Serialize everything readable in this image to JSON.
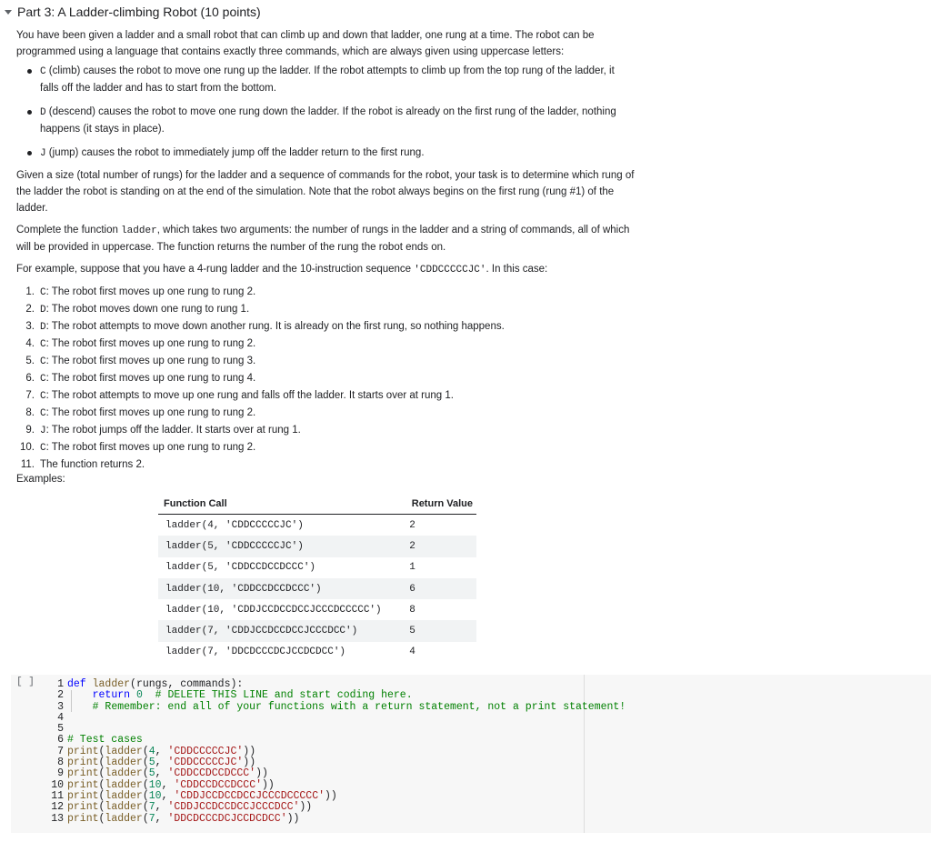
{
  "header": {
    "title": "Part 3: A Ladder-climbing Robot (10 points)"
  },
  "intro": "You have been given a ladder and a small robot that can climb up and down that ladder, one rung at a time. The robot can be programmed using a language that contains exactly three commands, which are always given using uppercase letters:",
  "commands": [
    {
      "code": "C",
      "text": " (climb) causes the robot to move one rung up the ladder. If the robot attempts to climb up from the top rung of the ladder, it falls off the ladder and has to start from the bottom."
    },
    {
      "code": "D",
      "text": " (descend) causes the robot to move one rung down the ladder. If the robot is already on the first rung of the ladder, nothing happens (it stays in place)."
    },
    {
      "code": "J",
      "text": " (jump) causes the robot to immediately jump off the ladder return to the first rung."
    }
  ],
  "task": "Given a size (total number of rungs) for the ladder and a sequence of commands for the robot, your task is to determine which rung of the ladder the robot is standing on at the end of the simulation. Note that the robot always begins on the first rung (rung #1) of the ladder.",
  "complete": {
    "pre": "Complete the function ",
    "fname": "ladder",
    "post": ", which takes two arguments: the number of rungs in the ladder and a string of commands, all of which will be provided in uppercase. The function returns the number of the rung the robot ends on."
  },
  "example_intro": {
    "pre": "For example, suppose that you have a 4-rung ladder and the 10-instruction sequence ",
    "code": "'CDDCCCCCJC'",
    "post": ". In this case:"
  },
  "steps": [
    {
      "n": "1.",
      "code": "C",
      "text": ": The robot first moves up one rung to rung 2."
    },
    {
      "n": "2.",
      "code": "D",
      "text": ": The robot moves down one rung to rung 1."
    },
    {
      "n": "3.",
      "code": "D",
      "text": ": The robot attempts to move down another rung. It is already on the first rung, so nothing happens."
    },
    {
      "n": "4.",
      "code": "C",
      "text": ": The robot first moves up one rung to rung 2."
    },
    {
      "n": "5.",
      "code": "C",
      "text": ": The robot first moves up one rung to rung 3."
    },
    {
      "n": "6.",
      "code": "C",
      "text": ": The robot first moves up one rung to rung 4."
    },
    {
      "n": "7.",
      "code": "C",
      "text": ": The robot attempts to move up one rung and falls off the ladder. It starts over at rung 1."
    },
    {
      "n": "8.",
      "code": "C",
      "text": ": The robot first moves up one rung to rung 2."
    },
    {
      "n": "9.",
      "code": "J",
      "text": ": The robot jumps off the ladder. It starts over at rung 1."
    },
    {
      "n": "10.",
      "code": "C",
      "text": ": The robot first moves up one rung to rung 2."
    },
    {
      "n": "11.",
      "code": "",
      "text": "The function returns 2."
    }
  ],
  "examples_label": "Examples:",
  "table": {
    "headers": [
      "Function Call",
      "Return Value"
    ],
    "rows": [
      [
        "ladder(4, 'CDDCCCCCJC')",
        "2"
      ],
      [
        "ladder(5, 'CDDCCCCCJC')",
        "2"
      ],
      [
        "ladder(5, 'CDDCCDCCDCCC')",
        "1"
      ],
      [
        "ladder(10, 'CDDCCDCCDCCC')",
        "6"
      ],
      [
        "ladder(10, 'CDDJCCDCCDCCJCCCDCCCCC')",
        "8"
      ],
      [
        "ladder(7, 'CDDJCCDCCDCCJCCCDCC')",
        "5"
      ],
      [
        "ladder(7, 'DDCDCCCDCJCCDCDCC')",
        "4"
      ]
    ]
  },
  "cell": {
    "run_label": "[ ]",
    "line_numbers": [
      "1",
      "2",
      "3",
      "4",
      "5",
      "6",
      "7",
      "8",
      "9",
      "10",
      "11",
      "12",
      "13"
    ],
    "code": {
      "l1_def": "def",
      "l1_fn": "ladder",
      "l1_rest": "(rungs, commands):",
      "l2_ret": "return",
      "l2_num": "0",
      "l2_cm": "# DELETE THIS LINE and start coding here.",
      "l3_cm": "# Remember: end all of your functions with a return statement, not a print statement!",
      "l6_cm": "# Test cases",
      "print_kw": "print",
      "ladder_fn": "ladder",
      "tests": [
        {
          "num": "4",
          "str": "'CDDCCCCCJC'"
        },
        {
          "num": "5",
          "str": "'CDDCCCCCJC'"
        },
        {
          "num": "5",
          "str": "'CDDCCDCCDCCC'"
        },
        {
          "num": "10",
          "str": "'CDDCCDCCDCCC'"
        },
        {
          "num": "10",
          "str": "'CDDJCCDCCDCCJCCCDCCCCC'"
        },
        {
          "num": "7",
          "str": "'CDDJCCDCCDCCJCCCDCC'"
        },
        {
          "num": "7",
          "str": "'DDCDCCCDCJCCDCDCC'"
        }
      ]
    }
  }
}
